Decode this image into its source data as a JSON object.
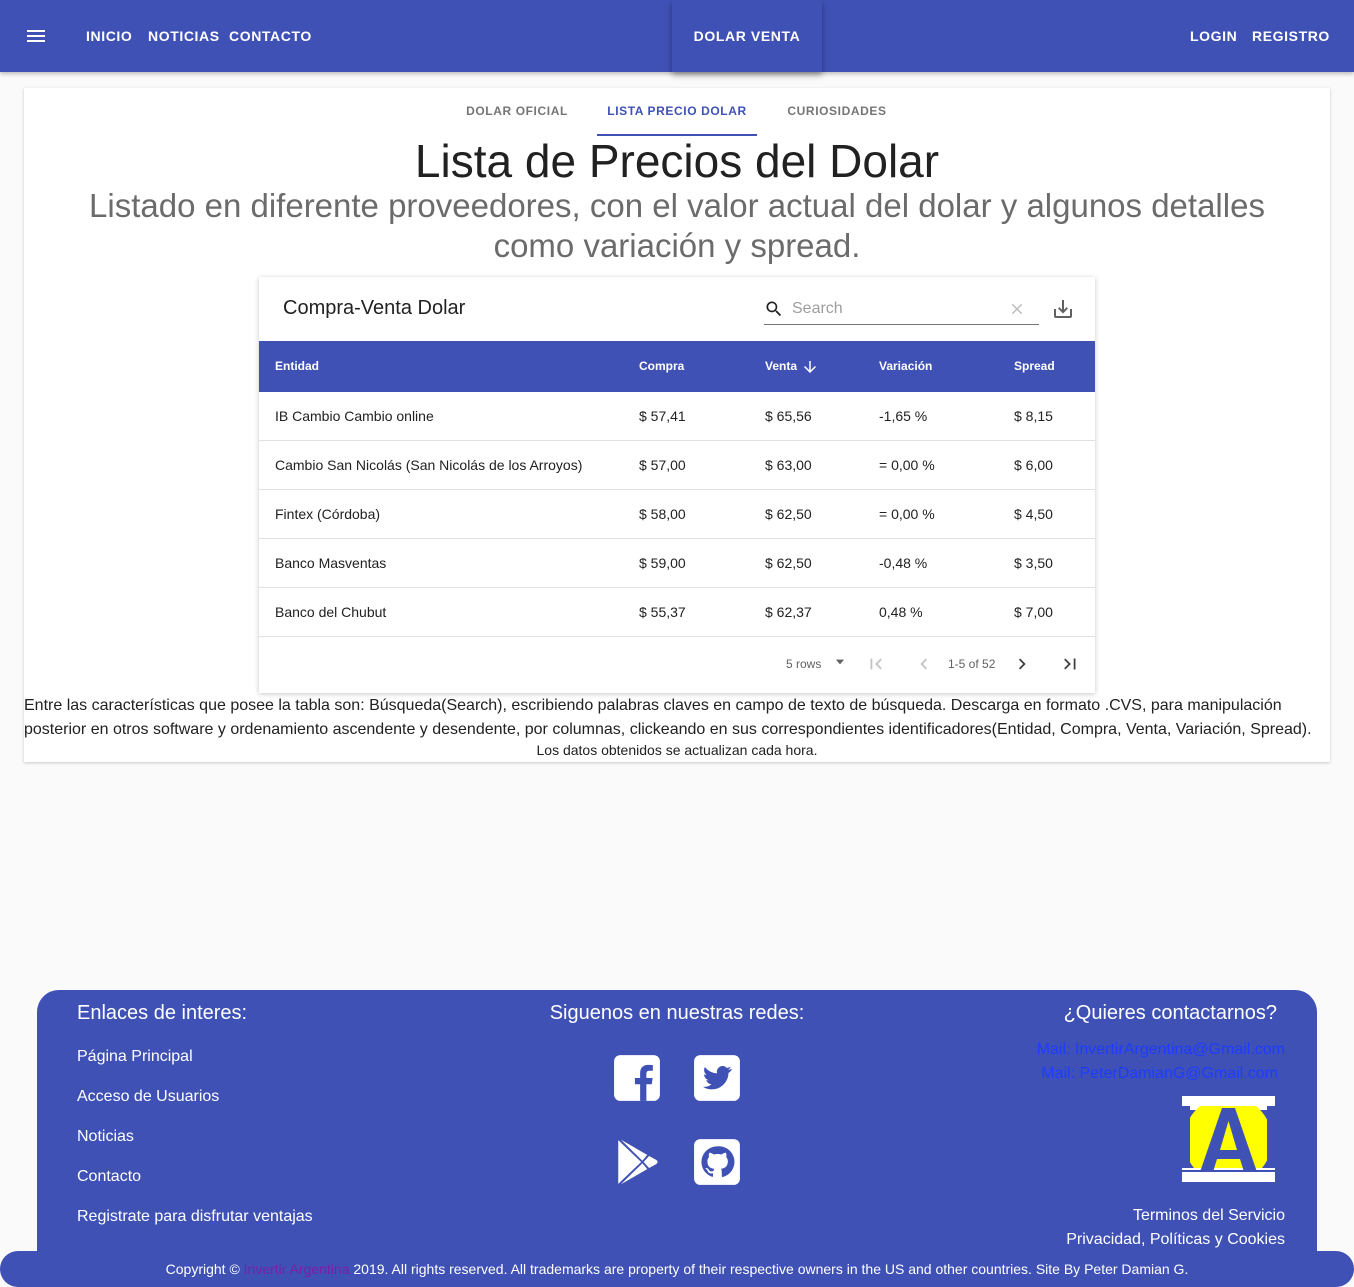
{
  "appbar": {
    "nav": [
      "INICIO",
      "NOTICIAS",
      "CONTACTO"
    ],
    "center_tab": "DOLAR VENTA",
    "login": "LOGIN",
    "register": "REGISTRO"
  },
  "tabs": [
    "DOLAR OFICIAL",
    "LISTA PRECIO DOLAR",
    "CURIOSIDADES"
  ],
  "active_tab": "LISTA PRECIO DOLAR",
  "page": {
    "title": "Lista de Precios del Dolar",
    "subtitle": "Listado en diferente proveedores, con el valor actual del dolar y algunos detalles como variación y spread."
  },
  "table": {
    "title": "Compra-Venta Dolar",
    "search_placeholder": "Search",
    "columns": [
      "Entidad",
      "Compra",
      "Venta",
      "Variación",
      "Spread"
    ],
    "sorted_column": "Venta",
    "rows": [
      [
        "IB Cambio Cambio online",
        "$ 57,41",
        "$ 65,56",
        "-1,65 %",
        "$ 8,15"
      ],
      [
        "Cambio San Nicolás (San Nicolás de los Arroyos)",
        "$ 57,00",
        "$ 63,00",
        "= 0,00 %",
        "$ 6,00"
      ],
      [
        "Fintex (Córdoba)",
        "$ 58,00",
        "$ 62,50",
        "= 0,00 %",
        "$ 4,50"
      ],
      [
        "Banco Masventas",
        "$ 59,00",
        "$ 62,50",
        "-0,48 %",
        "$ 3,50"
      ],
      [
        "Banco del Chubut",
        "$ 55,37",
        "$ 62,37",
        "0,48 %",
        "$ 7,00"
      ]
    ],
    "rows_per_page": "5 rows",
    "page_info": "1-5 of 52"
  },
  "description": {
    "main": "Entre las características que posee la tabla son: Búsqueda(Search), escribiendo palabras claves en campo de texto de búsqueda. Descarga en formato .CVS, para manipulación posterior en otros software y ordenamiento ascendente y desendente, por columnas, clickeando en sus correspondientes identificadores(Entidad, Compra, Venta, Variación, Spread).",
    "update": "Los datos obtenidos se actualizan cada hora."
  },
  "footer": {
    "links_title": "Enlaces de interes:",
    "links": [
      "Página Principal",
      "Acceso de Usuarios",
      "Noticias",
      "Contacto",
      "Registrate para disfrutar ventajas"
    ],
    "social_title": "Siguenos en nuestras redes:",
    "social_icons": [
      "facebook-icon",
      "twitter-icon",
      "google-play-icon",
      "github-icon"
    ],
    "contact_title": "¿Quieres contactarnos?",
    "mails": [
      "Mail: InvertirArgentina@Gmail.com",
      "Mail: PeterDamianG@Gmail.com"
    ],
    "terms": "Terminos del Servicio",
    "privacy": "Privacidad, Políticas y Cookies"
  },
  "copyright": {
    "prefix": "Copyright © ",
    "brand": "Invertir Argentina",
    "suffix": " 2019. All rights reserved. All trademarks are property of their respective owners in the US and other countries. Site By Peter Damian G."
  },
  "colors": {
    "primary": "#3f51b5",
    "mail_link": "#1e3cff",
    "brand_link": "#7b1fa2",
    "logo_circle": "#ffff00"
  }
}
